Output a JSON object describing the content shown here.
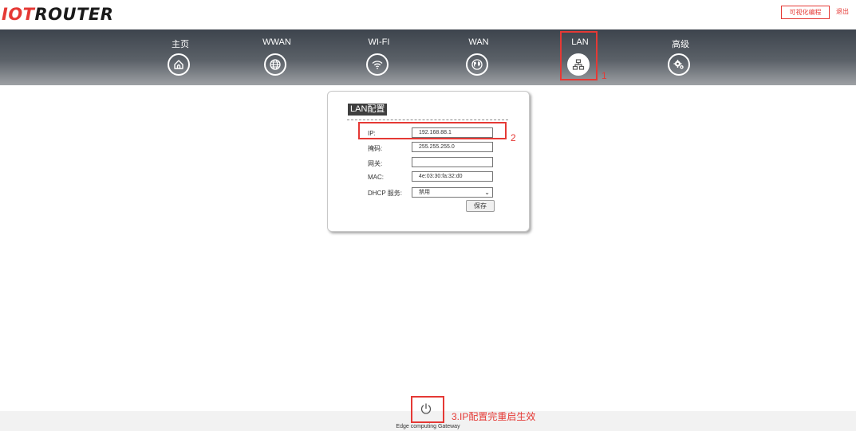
{
  "header": {
    "logo_accent": "IOT",
    "logo_rest": "ROUTER",
    "visual_programming": "可视化编程",
    "logout": "退出"
  },
  "nav": {
    "items": [
      {
        "label": "主页",
        "icon": "home-icon"
      },
      {
        "label": "WWAN",
        "icon": "globe-icon"
      },
      {
        "label": "WI-FI",
        "icon": "wifi-icon"
      },
      {
        "label": "WAN",
        "icon": "earth-icon"
      },
      {
        "label": "LAN",
        "icon": "network-icon",
        "active": true
      },
      {
        "label": "高级",
        "icon": "gears-icon"
      }
    ]
  },
  "annotations": {
    "step1": "1",
    "step2": "2",
    "step3": "3.IP配置完重启生效"
  },
  "lan": {
    "title": "LAN配置",
    "ip_label": "IP:",
    "ip_value": "192.168.88.1",
    "mask_label": "掩码:",
    "mask_value": "255.255.255.0",
    "gateway_label": "网关:",
    "gateway_value": "",
    "mac_label": "MAC:",
    "mac_value": "4e:03:30:fa:32:d0",
    "dhcp_label": "DHCP 服务:",
    "dhcp_value": "禁用",
    "save_label": "保存"
  },
  "footer": {
    "text": "Edge computing Gateway"
  },
  "colors": {
    "accent_red": "#e53935",
    "nav_dark": "#3d444d"
  }
}
